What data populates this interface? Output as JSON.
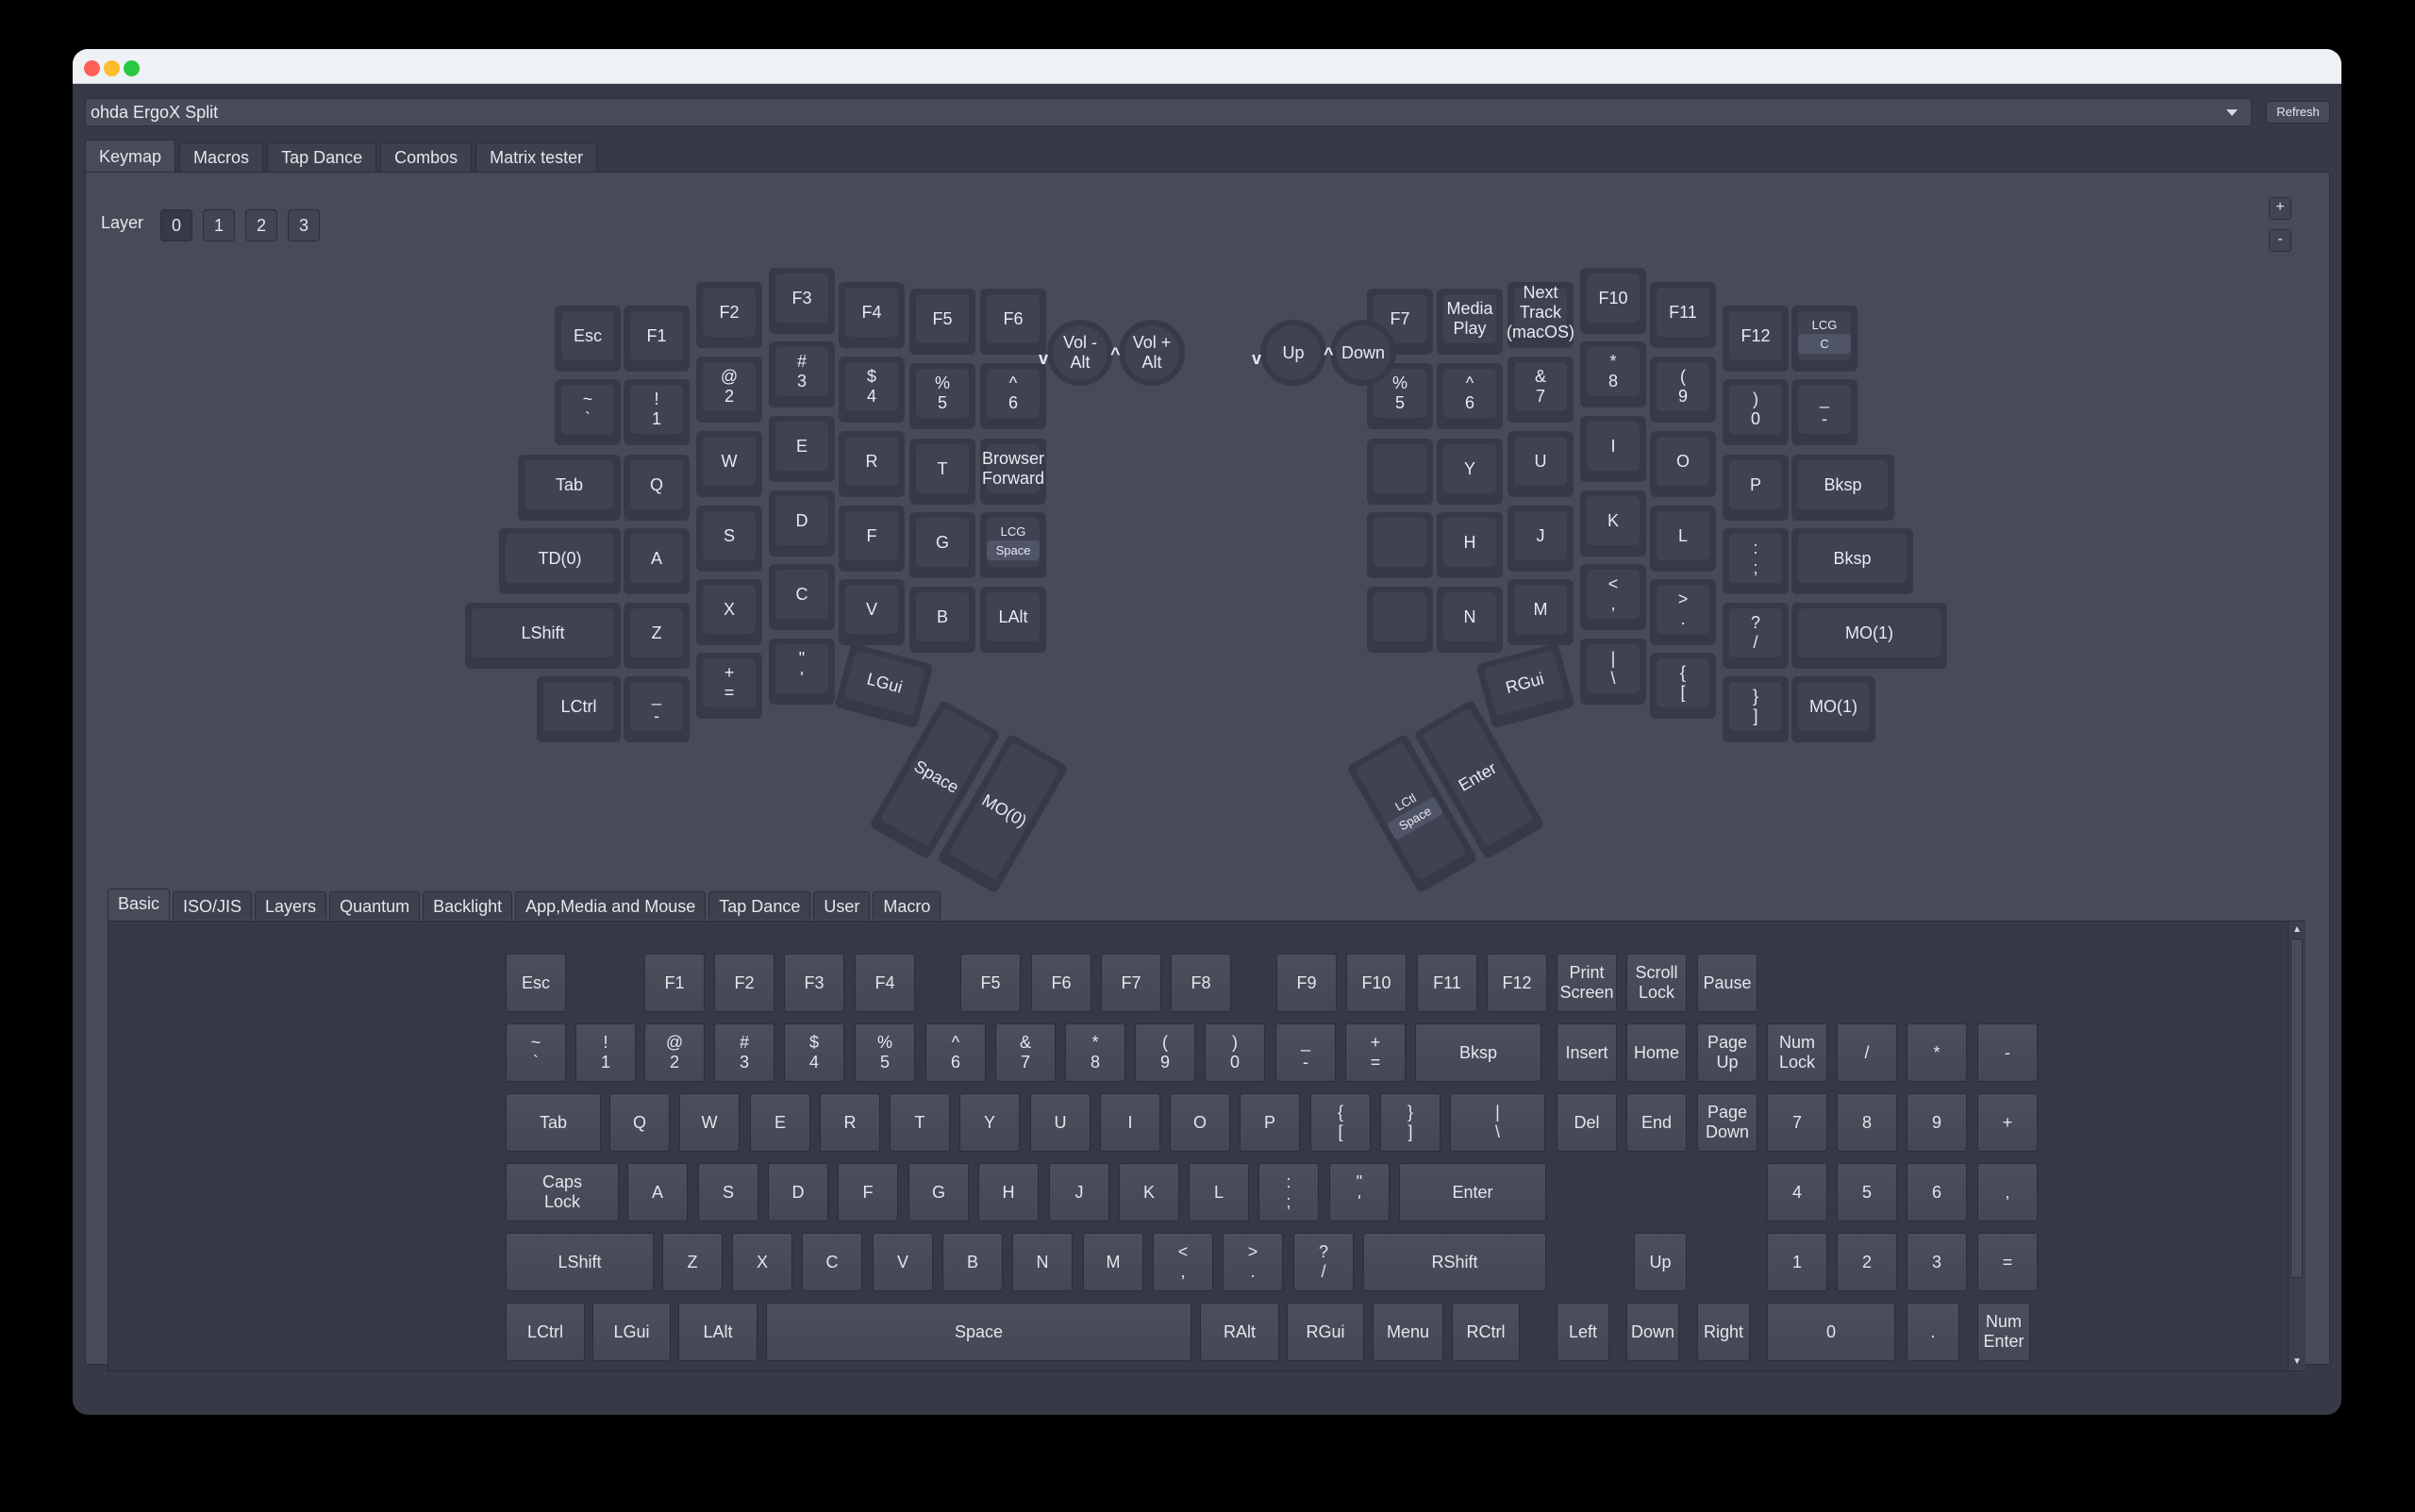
{
  "window": {
    "device_name": "ohda ErgoX Split",
    "refresh_label": "Refresh"
  },
  "main_tabs": [
    "Keymap",
    "Macros",
    "Tap Dance",
    "Combos",
    "Matrix tester"
  ],
  "active_main_tab": "Keymap",
  "layer": {
    "label": "Layer",
    "options": [
      "0",
      "1",
      "2",
      "3"
    ],
    "active": "0"
  },
  "zoom": {
    "plus": "+",
    "minus": "-"
  },
  "keymap": {
    "left": [
      {
        "id": "esc",
        "label": "Esc"
      },
      {
        "id": "f1",
        "label": "F1"
      },
      {
        "id": "f2",
        "label": "F2"
      },
      {
        "id": "f3",
        "label": "F3"
      },
      {
        "id": "f4",
        "label": "F4"
      },
      {
        "id": "f5",
        "label": "F5"
      },
      {
        "id": "f6",
        "label": "F6"
      },
      {
        "id": "grave",
        "label": "~\n`"
      },
      {
        "id": "1",
        "label": "!\n1"
      },
      {
        "id": "2",
        "label": "@\n2"
      },
      {
        "id": "3",
        "label": "#\n3"
      },
      {
        "id": "4",
        "label": "$\n4"
      },
      {
        "id": "5",
        "label": "%\n5"
      },
      {
        "id": "6",
        "label": "^\n6"
      },
      {
        "id": "tab",
        "label": "Tab"
      },
      {
        "id": "q",
        "label": "Q"
      },
      {
        "id": "w",
        "label": "W"
      },
      {
        "id": "e",
        "label": "E"
      },
      {
        "id": "r",
        "label": "R"
      },
      {
        "id": "t",
        "label": "T"
      },
      {
        "id": "browser-forward",
        "label": "Browser\nForward"
      },
      {
        "id": "td0",
        "label": "TD(0)"
      },
      {
        "id": "a",
        "label": "A"
      },
      {
        "id": "s",
        "label": "S"
      },
      {
        "id": "d",
        "label": "D"
      },
      {
        "id": "f",
        "label": "F"
      },
      {
        "id": "g",
        "label": "G"
      },
      {
        "id": "lcg-space",
        "label": "LCG",
        "sub": "Space"
      },
      {
        "id": "lshift",
        "label": "LShift"
      },
      {
        "id": "z",
        "label": "Z"
      },
      {
        "id": "x",
        "label": "X"
      },
      {
        "id": "c",
        "label": "C"
      },
      {
        "id": "v",
        "label": "V"
      },
      {
        "id": "b",
        "label": "B"
      },
      {
        "id": "lalt",
        "label": "LAlt"
      },
      {
        "id": "lctrl",
        "label": "LCtrl"
      },
      {
        "id": "minus",
        "label": "_\n-"
      },
      {
        "id": "equal",
        "label": "+\n="
      },
      {
        "id": "quote",
        "label": "\"\n'"
      },
      {
        "id": "lgui",
        "label": "LGui"
      },
      {
        "id": "space",
        "label": "Space"
      },
      {
        "id": "mo0",
        "label": "MO(0)"
      }
    ],
    "left_encoder": {
      "ccw": "Vol -\nAlt",
      "cw": "Vol +\nAlt"
    },
    "right_encoder": {
      "ccw": "Up",
      "cw": "Down"
    },
    "encoder_arrows": {
      "ccw": "v",
      "cw": "^"
    },
    "right": [
      {
        "id": "f7",
        "label": "F7"
      },
      {
        "id": "media-play",
        "label": "Media\nPlay"
      },
      {
        "id": "next-track",
        "label": "Next\nTrack\n(macOS)"
      },
      {
        "id": "f10",
        "label": "F10"
      },
      {
        "id": "f11",
        "label": "F11"
      },
      {
        "id": "f12",
        "label": "F12"
      },
      {
        "id": "lcg-c",
        "label": "LCG",
        "sub": "C"
      },
      {
        "id": "r5",
        "label": "%\n5"
      },
      {
        "id": "r6",
        "label": "^\n6"
      },
      {
        "id": "7",
        "label": "&\n7"
      },
      {
        "id": "8",
        "label": "*\n8"
      },
      {
        "id": "9",
        "label": "(\n9"
      },
      {
        "id": "0",
        "label": ")\n0"
      },
      {
        "id": "rminus",
        "label": "_\n-"
      },
      {
        "id": "blank1",
        "label": ""
      },
      {
        "id": "y",
        "label": "Y"
      },
      {
        "id": "u",
        "label": "U"
      },
      {
        "id": "i",
        "label": "I"
      },
      {
        "id": "o",
        "label": "O"
      },
      {
        "id": "p",
        "label": "P"
      },
      {
        "id": "bksp1",
        "label": "Bksp"
      },
      {
        "id": "blank2",
        "label": ""
      },
      {
        "id": "h",
        "label": "H"
      },
      {
        "id": "j",
        "label": "J"
      },
      {
        "id": "k",
        "label": "K"
      },
      {
        "id": "l",
        "label": "L"
      },
      {
        "id": "semicolon",
        "label": ":\n;"
      },
      {
        "id": "bksp2",
        "label": "Bksp"
      },
      {
        "id": "blank3",
        "label": ""
      },
      {
        "id": "n",
        "label": "N"
      },
      {
        "id": "m",
        "label": "M"
      },
      {
        "id": "comma",
        "label": "<\n,"
      },
      {
        "id": "period",
        "label": ">\n."
      },
      {
        "id": "slash",
        "label": "?\n/"
      },
      {
        "id": "mo1a",
        "label": "MO(1)"
      },
      {
        "id": "backslash",
        "label": "|\n\\"
      },
      {
        "id": "lbracket",
        "label": "{\n["
      },
      {
        "id": "rbracket",
        "label": "}\n]"
      },
      {
        "id": "mo1b",
        "label": "MO(1)"
      },
      {
        "id": "rgui",
        "label": "RGui"
      },
      {
        "id": "enter",
        "label": "Enter"
      },
      {
        "id": "lctl-space",
        "label": "LCtl",
        "sub": "Space"
      }
    ]
  },
  "palette_tabs": [
    "Basic",
    "ISO/JIS",
    "Layers",
    "Quantum",
    "Backlight",
    "App,Media and Mouse",
    "Tap Dance",
    "User",
    "Macro"
  ],
  "active_palette_tab": "Basic",
  "palette_keys": [
    [
      "Esc",
      "F1",
      "F2",
      "F3",
      "F4",
      "F5",
      "F6",
      "F7",
      "F8",
      "F9",
      "F10",
      "F11",
      "F12",
      "Print\nScreen",
      "Scroll\nLock",
      "Pause"
    ],
    [
      "~\n`",
      "!\n1",
      "@\n2",
      "#\n3",
      "$\n4",
      "%\n5",
      "^\n6",
      "&\n7",
      "*\n8",
      "(\n9",
      ")\n0",
      "_\n-",
      "+\n=",
      "Bksp",
      "Insert",
      "Home",
      "Page\nUp",
      "Num\nLock",
      "/",
      "*",
      "-"
    ],
    [
      "Tab",
      "Q",
      "W",
      "E",
      "R",
      "T",
      "Y",
      "U",
      "I",
      "O",
      "P",
      "{\n[",
      "}\n]",
      "|\n\\",
      "Del",
      "End",
      "Page\nDown",
      "7",
      "8",
      "9",
      "+"
    ],
    [
      "Caps\nLock",
      "A",
      "S",
      "D",
      "F",
      "G",
      "H",
      "J",
      "K",
      "L",
      ":\n;",
      "\"\n'",
      "Enter",
      "4",
      "5",
      "6",
      ","
    ],
    [
      "LShift",
      "Z",
      "X",
      "C",
      "V",
      "B",
      "N",
      "M",
      "<\n,",
      ">\n.",
      "?\n/",
      "RShift",
      "Up",
      "1",
      "2",
      "3",
      "="
    ],
    [
      "LCtrl",
      "LGui",
      "LAlt",
      "Space",
      "RAlt",
      "RGui",
      "Menu",
      "RCtrl",
      "Left",
      "Down",
      "Right",
      "0",
      ".",
      "Num\nEnter"
    ]
  ],
  "scrollbar": {
    "up": "▲",
    "down": "▼"
  },
  "colors": {
    "highlight_sub": "#4f5466",
    "keycap": "#3e4251",
    "panel": "#474b58"
  }
}
